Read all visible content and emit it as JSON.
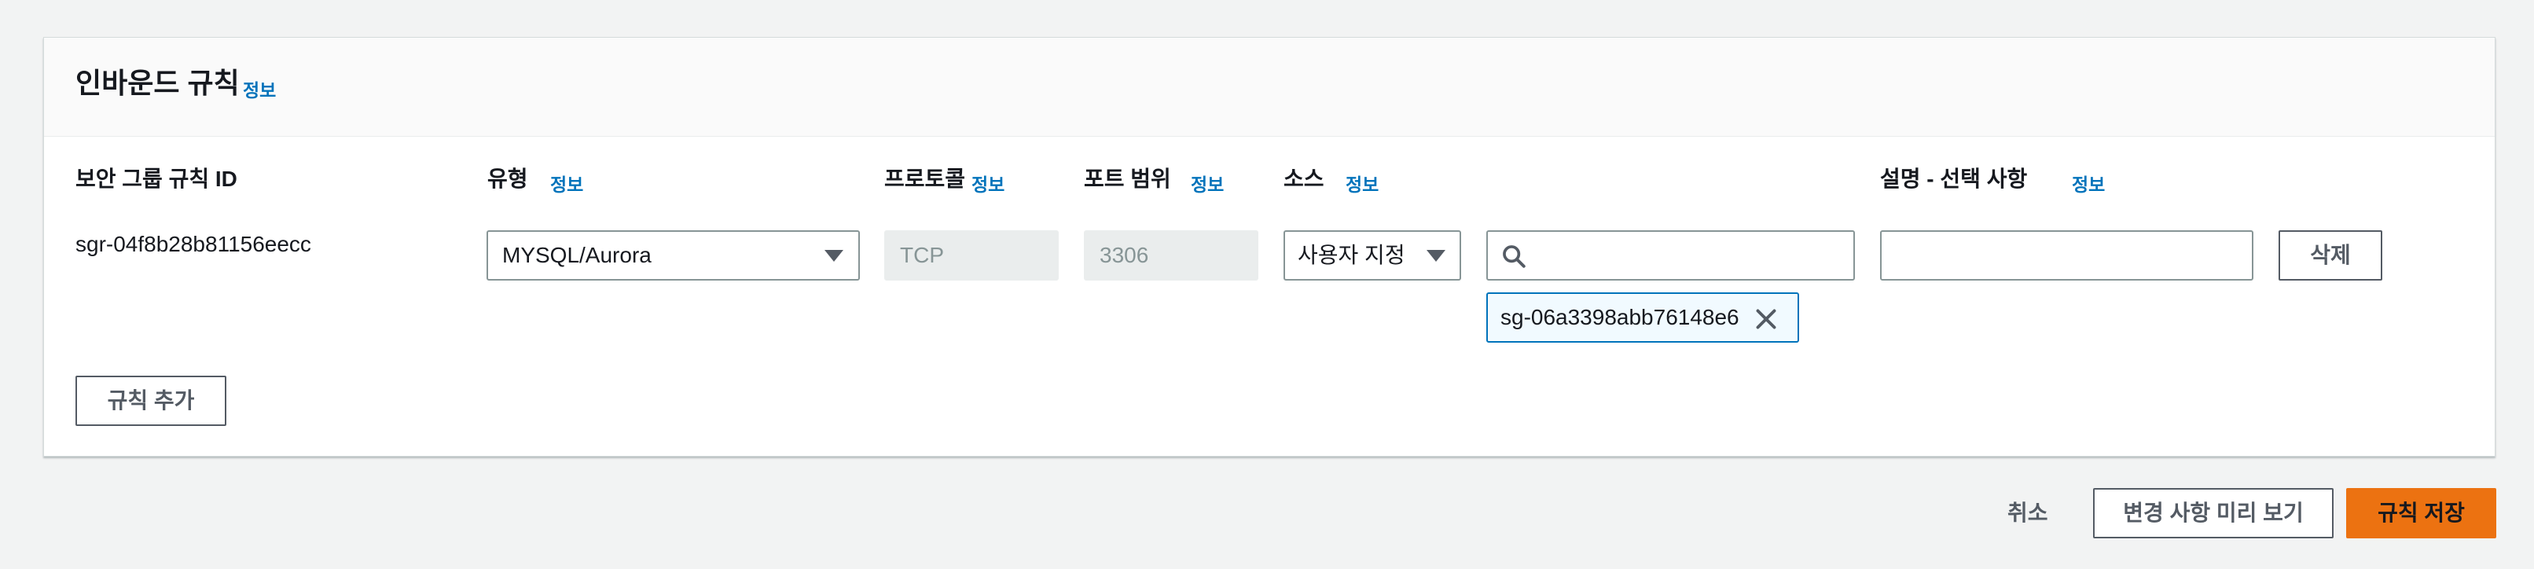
{
  "panel": {
    "title": "인바운드 규칙",
    "info_label": "정보"
  },
  "columns": [
    {
      "label": "보안 그룹 규칙 ID"
    },
    {
      "label": "유형",
      "info": "정보"
    },
    {
      "label": "프로토콜",
      "info": "정보"
    },
    {
      "label": "포트 범위",
      "info": "정보"
    },
    {
      "label": "소스",
      "info": "정보"
    },
    {
      "label": "설명 - 선택 사항",
      "info": "정보"
    }
  ],
  "rule": {
    "id": "sgr-04f8b28b81156eecc",
    "type": "MYSQL/Aurora",
    "protocol_placeholder": "TCP",
    "port_placeholder": "3306",
    "source": "사용자 지정",
    "search_value": "",
    "source_token": "sg-06a3398abb76148e6",
    "description_value": "",
    "delete_label": "삭제"
  },
  "add_rule_label": "규칙 추가",
  "footer": {
    "cancel_label": "취소",
    "preview_label": "변경 사항 미리 보기",
    "save_label": "규칙 저장"
  },
  "colors": {
    "primary": "#ec7211",
    "link": "#0073bb",
    "token_border": "#0073bb"
  },
  "icons": [
    "search-icon",
    "close-icon",
    "caret-down-icon"
  ]
}
